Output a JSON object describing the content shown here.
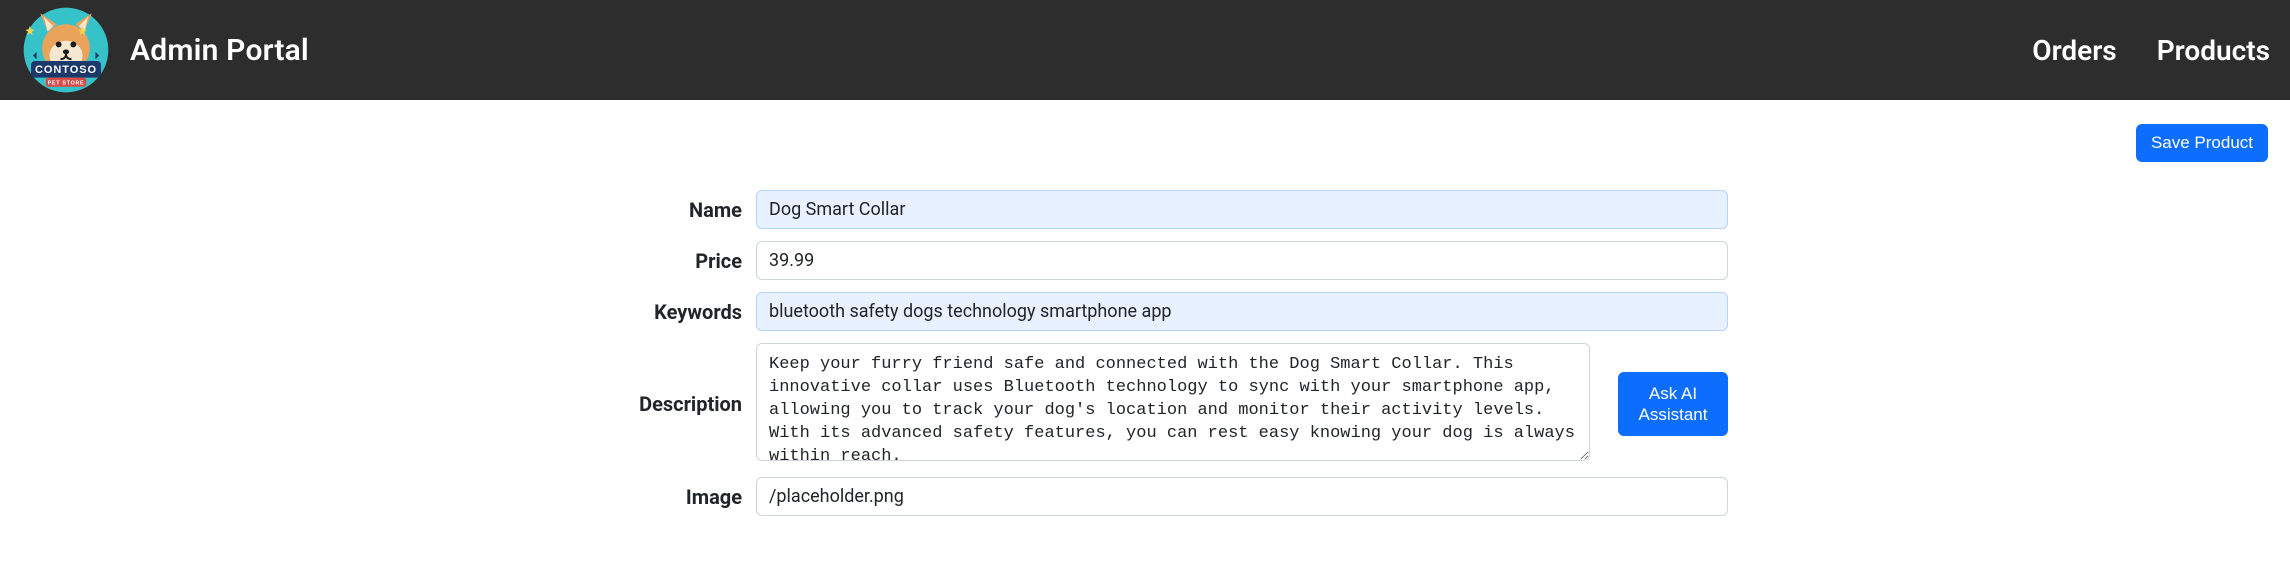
{
  "header": {
    "title": "Admin Portal",
    "nav": {
      "orders": "Orders",
      "products": "Products"
    }
  },
  "toolbar": {
    "save_label": "Save Product"
  },
  "form": {
    "name": {
      "label": "Name",
      "value": "Dog Smart Collar"
    },
    "price": {
      "label": "Price",
      "value": "39.99"
    },
    "keywords": {
      "label": "Keywords",
      "value": "bluetooth safety dogs technology smartphone app"
    },
    "description": {
      "label": "Description",
      "value": "Keep your furry friend safe and connected with the Dog Smart Collar. This innovative collar uses Bluetooth technology to sync with your smartphone app, allowing you to track your dog's location and monitor their activity levels. With its advanced safety features, you can rest easy knowing your dog is always within reach."
    },
    "image": {
      "label": "Image",
      "value": "/placeholder.png"
    },
    "ai_button": "Ask AI Assistant"
  },
  "logo": {
    "brand_top": "CONTOSO",
    "brand_sub": "PET STORE"
  }
}
